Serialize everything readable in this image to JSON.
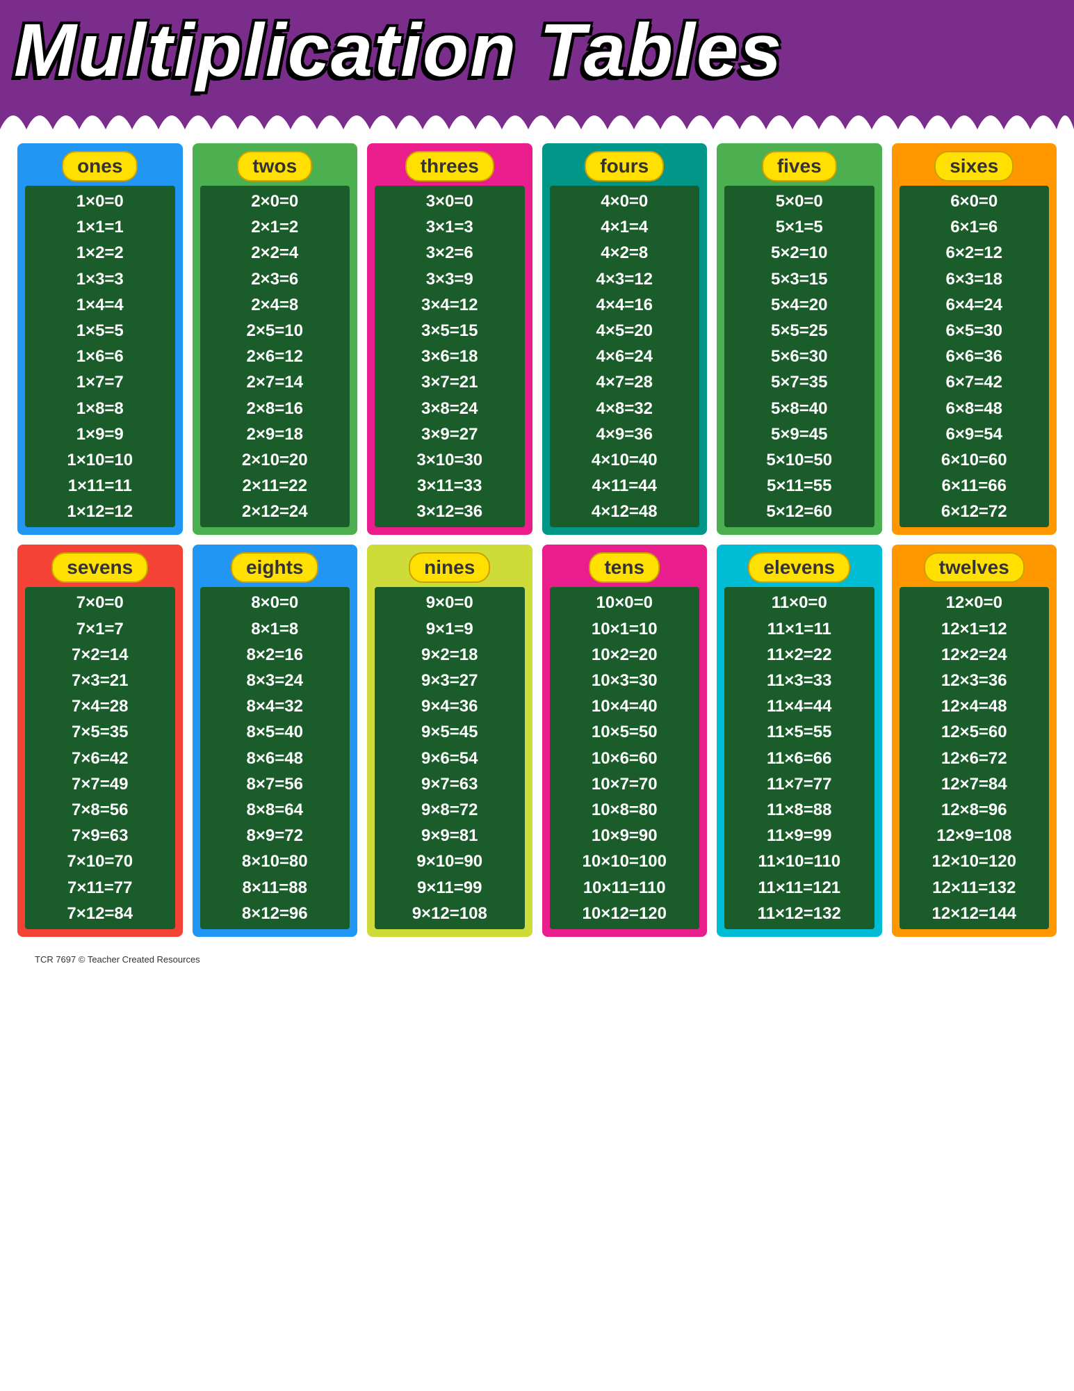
{
  "header": {
    "title": "Multiplication Tables",
    "bg_color": "#7B2D8B"
  },
  "footer": "TCR 7697  © Teacher Created Resources",
  "tables": [
    {
      "id": "ones",
      "label": "ones",
      "border": "blue-border",
      "multiplier": 1,
      "rows": [
        "1x0=0",
        "1x1=1",
        "1x2=2",
        "1x3=3",
        "1x4=4",
        "1x5=5",
        "1x6=6",
        "1x7=7",
        "1x8=8",
        "1x9=9",
        "1x10=10",
        "1x11=11",
        "1x12=12"
      ]
    },
    {
      "id": "twos",
      "label": "twos",
      "border": "green-border",
      "multiplier": 2,
      "rows": [
        "2x0=0",
        "2x1=2",
        "2x2=4",
        "2x3=6",
        "2x4=8",
        "2x5=10",
        "2x6=12",
        "2x7=14",
        "2x8=16",
        "2x9=18",
        "2x10=20",
        "2x11=22",
        "2x12=24"
      ]
    },
    {
      "id": "threes",
      "label": "threes",
      "border": "pink-border",
      "multiplier": 3,
      "rows": [
        "3x0=0",
        "3x1=3",
        "3x2=6",
        "3x3=9",
        "3x4=12",
        "3x5=15",
        "3x6=18",
        "3x7=21",
        "3x8=24",
        "3x9=27",
        "3x10=30",
        "3x11=33",
        "3x12=36"
      ]
    },
    {
      "id": "fours",
      "label": "fours",
      "border": "teal-border",
      "multiplier": 4,
      "rows": [
        "4x0=0",
        "4x1=4",
        "4x2=8",
        "4x3=12",
        "4x4=16",
        "4x5=20",
        "4x6=24",
        "4x7=28",
        "4x8=32",
        "4x9=36",
        "4x10=40",
        "4x11=44",
        "4x12=48"
      ]
    },
    {
      "id": "fives",
      "label": "fives",
      "border": "green-border",
      "multiplier": 5,
      "rows": [
        "5x0=0",
        "5x1=5",
        "5x2=10",
        "5x3=15",
        "5x4=20",
        "5x5=25",
        "5x6=30",
        "5x7=35",
        "5x8=40",
        "5x9=45",
        "5x10=50",
        "5x11=55",
        "5x12=60"
      ]
    },
    {
      "id": "sixes",
      "label": "sixes",
      "border": "orange-border",
      "multiplier": 6,
      "rows": [
        "6x0=0",
        "6x1=6",
        "6x2=12",
        "6x3=18",
        "6x4=24",
        "6x5=30",
        "6x6=36",
        "6x7=42",
        "6x8=48",
        "6x9=54",
        "6x10=60",
        "6x11=66",
        "6x12=72"
      ]
    },
    {
      "id": "sevens",
      "label": "sevens",
      "border": "red-border",
      "multiplier": 7,
      "rows": [
        "7x0=0",
        "7x1=7",
        "7x2=14",
        "7x3=21",
        "7x4=28",
        "7x5=35",
        "7x6=42",
        "7x7=49",
        "7x8=56",
        "7x9=63",
        "7x10=70",
        "7x11=77",
        "7x12=84"
      ]
    },
    {
      "id": "eights",
      "label": "eights",
      "border": "blue-border",
      "multiplier": 8,
      "rows": [
        "8x0=0",
        "8x1=8",
        "8x2=16",
        "8x3=24",
        "8x4=32",
        "8x5=40",
        "8x6=48",
        "8x7=56",
        "8x8=64",
        "8x9=72",
        "8x10=80",
        "8x11=88",
        "8x12=96"
      ]
    },
    {
      "id": "nines",
      "label": "nines",
      "border": "yellow-border",
      "multiplier": 9,
      "rows": [
        "9x0=0",
        "9x1=9",
        "9x2=18",
        "9x3=27",
        "9x4=36",
        "9x5=45",
        "9x6=54",
        "9x7=63",
        "9x8=72",
        "9x9=81",
        "9x10=90",
        "9x11=99",
        "9x12=108"
      ]
    },
    {
      "id": "tens",
      "label": "tens",
      "border": "pink-border",
      "multiplier": 10,
      "rows": [
        "10x0=0",
        "10x1=10",
        "10x2=20",
        "10x3=30",
        "10x4=40",
        "10x5=50",
        "10x6=60",
        "10x7=70",
        "10x8=80",
        "10x9=90",
        "10x10=100",
        "10x11=110",
        "10x12=120"
      ]
    },
    {
      "id": "elevens",
      "label": "elevens",
      "border": "cyan-border",
      "multiplier": 11,
      "rows": [
        "11x0=0",
        "11x1=11",
        "11x2=22",
        "11x3=33",
        "11x4=44",
        "11x5=55",
        "11x6=66",
        "11x7=77",
        "11x8=88",
        "11x9=99",
        "11x10=110",
        "11x11=121",
        "11x12=132"
      ]
    },
    {
      "id": "twelves",
      "label": "twelves",
      "border": "orange-border",
      "multiplier": 12,
      "rows": [
        "12x0=0",
        "12x1=12",
        "12x2=24",
        "12x3=36",
        "12x4=48",
        "12x5=60",
        "12x6=72",
        "12x7=84",
        "12x8=96",
        "12x9=108",
        "12x10=120",
        "12x11=132",
        "12x12=144"
      ]
    }
  ]
}
